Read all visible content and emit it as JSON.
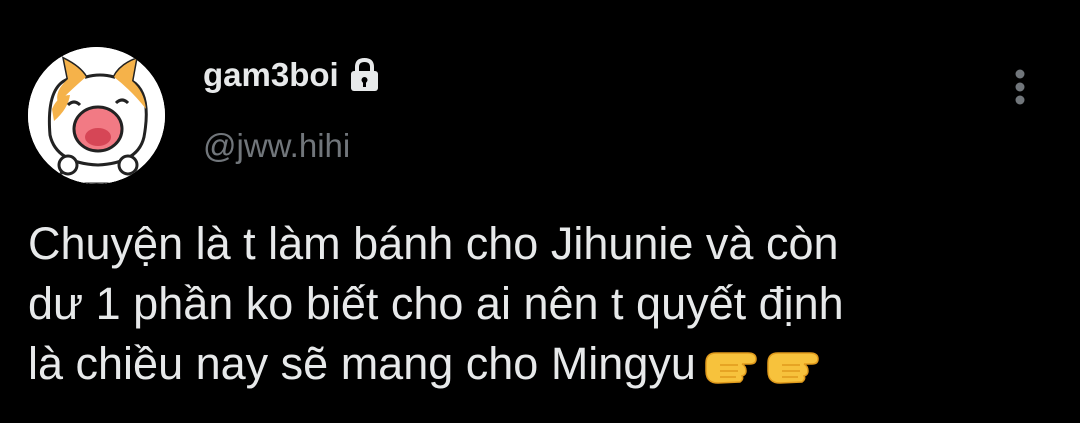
{
  "user": {
    "display_name": "gam3boi",
    "handle": "@jww.hihi",
    "avatar_icon": "cat-avatar-icon",
    "protected_icon": "lock-icon"
  },
  "tweet": {
    "lines": [
      "Chuyện là t làm bánh cho Jihunie và còn",
      "dư 1 phần ko biết cho ai nên t quyết định",
      "là chiều nay sẽ mang cho Mingyu"
    ],
    "emoji": [
      "backhand-index-pointing-right",
      "backhand-index-pointing-right"
    ]
  },
  "menu": {
    "icon": "more-vertical-icon"
  },
  "colors": {
    "background": "#000000",
    "text": "#e7e9ea",
    "secondary": "#71767b"
  }
}
